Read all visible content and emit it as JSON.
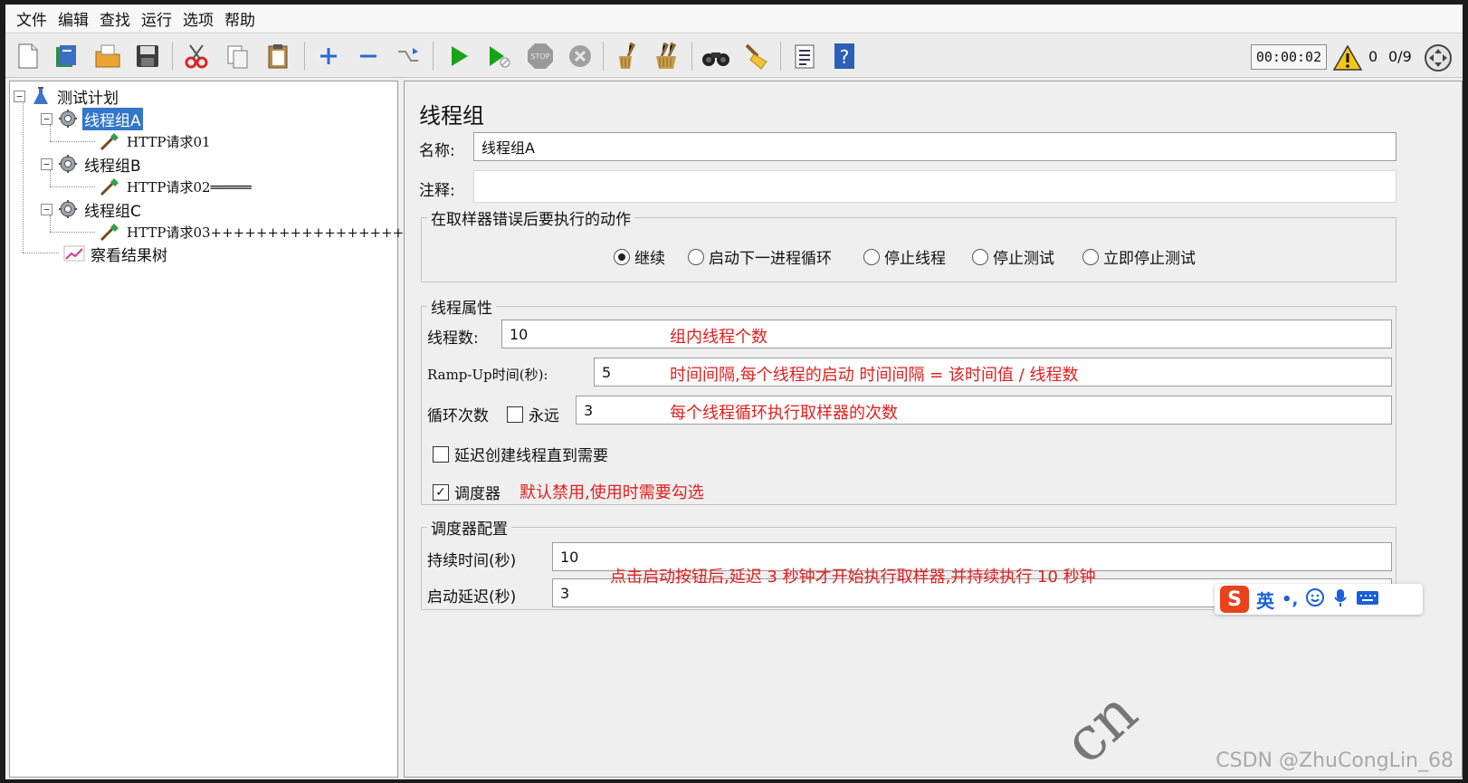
{
  "menu": [
    "文件",
    "编辑",
    "查找",
    "运行",
    "选项",
    "帮助"
  ],
  "toolbar": {
    "timer": "00:00:02",
    "warning_count": "0",
    "thread_ratio": "0/9"
  },
  "tree": {
    "root": "测试计划",
    "nodes": [
      {
        "label": "线程组A",
        "selected": true
      },
      {
        "label": "HTTP请求01"
      },
      {
        "label": "线程组B"
      },
      {
        "label": "HTTP请求02═════"
      },
      {
        "label": "线程组C"
      },
      {
        "label": "HTTP请求03++++++++++++++++++"
      },
      {
        "label": "察看结果树"
      }
    ]
  },
  "panel": {
    "title": "线程组",
    "name_label": "名称:",
    "name_value": "线程组A",
    "comment_label": "注释:",
    "comment_value": "",
    "error_action": {
      "legend": "在取样器错误后要执行的动作",
      "options": [
        "继续",
        "启动下一进程循环",
        "停止线程",
        "停止测试",
        "立即停止测试"
      ],
      "selected": "继续"
    },
    "thread_props": {
      "legend": "线程属性",
      "threads_label": "线程数:",
      "threads_value": "10",
      "rampup_label": "Ramp-Up时间(秒):",
      "rampup_value": "5",
      "loop_label": "循环次数",
      "forever_label": "永远",
      "forever_checked": false,
      "loop_value": "3",
      "delay_label": "延迟创建线程直到需要",
      "delay_checked": false,
      "scheduler_label": "调度器",
      "scheduler_checked": true
    },
    "scheduler_config": {
      "legend": "调度器配置",
      "duration_label": "持续时间(秒)",
      "duration_value": "10",
      "startup_label": "启动延迟(秒)",
      "startup_value": "3"
    }
  },
  "annotations": {
    "threads": "组内线程个数",
    "rampup": "时间间隔,每个线程的启动 时间间隔 = 该时间值 / 线程数",
    "loop": "每个线程循环执行取样器的次数",
    "scheduler": "默认禁用,使用时需要勾选",
    "schedule_config": "点击启动按钮后,延迟 3 秒钟才开始执行取样器,并持续执行 10 秒钟"
  },
  "ime": {
    "mode": "英"
  },
  "watermark": "CSDN @ZhuCongLin_68",
  "watermark_cn": "cn",
  "colors": {
    "accent": "#3476c9",
    "annotation": "#e02020",
    "run": "#19a319"
  }
}
